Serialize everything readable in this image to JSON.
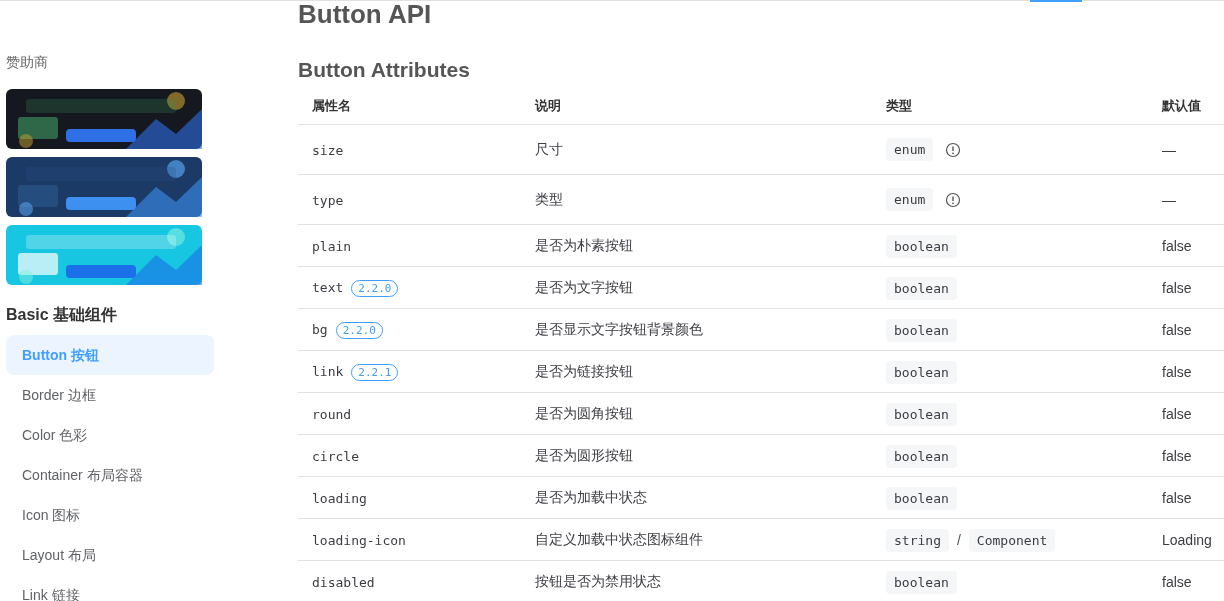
{
  "sidebar": {
    "sponsor_label": "赞助商",
    "section_title": "Basic 基础组件",
    "items": [
      {
        "label": "Button 按钮",
        "selected": true
      },
      {
        "label": "Border 边框",
        "selected": false
      },
      {
        "label": "Color 色彩",
        "selected": false
      },
      {
        "label": "Container 布局容器",
        "selected": false
      },
      {
        "label": "Icon 图标",
        "selected": false
      },
      {
        "label": "Layout 布局",
        "selected": false
      },
      {
        "label": "Link 链接",
        "selected": false
      }
    ]
  },
  "page_title": "Button API",
  "section_title": "Button Attributes",
  "table": {
    "columns": [
      "属性名",
      "说明",
      "类型",
      "默认值"
    ],
    "rows": [
      {
        "name": "size",
        "description": "尺寸",
        "types": [
          "enum"
        ],
        "info": true,
        "default": "—"
      },
      {
        "name": "type",
        "description": "类型",
        "types": [
          "enum"
        ],
        "info": true,
        "default": "—"
      },
      {
        "name": "plain",
        "description": "是否为朴素按钮",
        "types": [
          "boolean"
        ],
        "info": false,
        "default": "false"
      },
      {
        "name": "text",
        "badge": "2.2.0",
        "description": "是否为文字按钮",
        "types": [
          "boolean"
        ],
        "info": false,
        "default": "false"
      },
      {
        "name": "bg",
        "badge": "2.2.0",
        "description": "是否显示文字按钮背景颜色",
        "types": [
          "boolean"
        ],
        "info": false,
        "default": "false"
      },
      {
        "name": "link",
        "badge": "2.2.1",
        "description": "是否为链接按钮",
        "types": [
          "boolean"
        ],
        "info": false,
        "default": "false"
      },
      {
        "name": "round",
        "description": "是否为圆角按钮",
        "types": [
          "boolean"
        ],
        "info": false,
        "default": "false"
      },
      {
        "name": "circle",
        "description": "是否为圆形按钮",
        "types": [
          "boolean"
        ],
        "info": false,
        "default": "false"
      },
      {
        "name": "loading",
        "description": "是否为加载中状态",
        "types": [
          "boolean"
        ],
        "info": false,
        "default": "false"
      },
      {
        "name": "loading-icon",
        "description": "自定义加载中状态图标组件",
        "types": [
          "string",
          "Component"
        ],
        "type_separator": "/",
        "info": false,
        "default": "Loading"
      },
      {
        "name": "disabled",
        "description": "按钮是否为禁用状态",
        "types": [
          "boolean"
        ],
        "info": false,
        "default": "false"
      }
    ]
  }
}
